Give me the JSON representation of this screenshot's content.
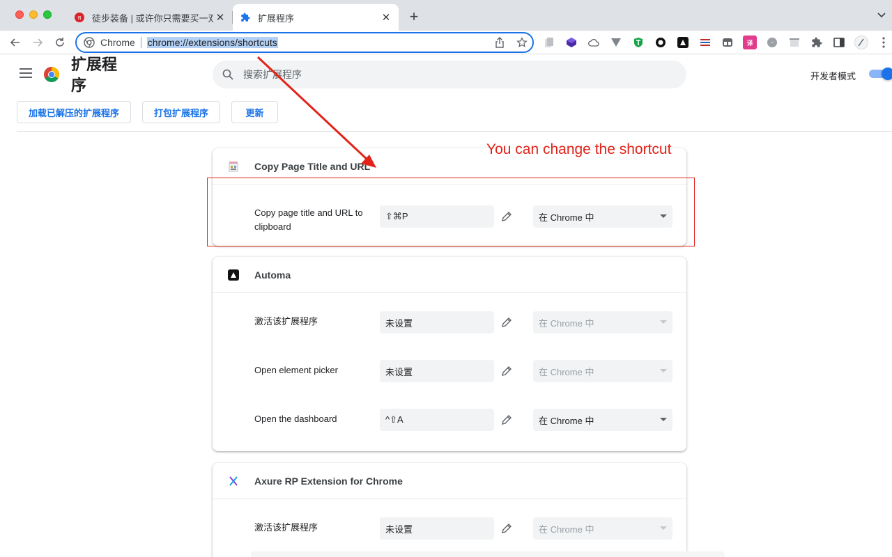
{
  "browser": {
    "tabs": [
      {
        "title": "徒步装备 | 或许你只需要买一双鞋",
        "favicon": "red-circle-logo",
        "active": false
      },
      {
        "title": "扩展程序",
        "favicon": "puzzle-icon",
        "active": true
      }
    ],
    "omnibox": {
      "chip": "Chrome",
      "url": "chrome://extensions/shortcuts"
    }
  },
  "header": {
    "title": "扩展程序",
    "search_placeholder": "搜索扩展程序",
    "devmode_label": "开发者模式",
    "devmode_on": true
  },
  "actions": {
    "load_unpacked": "加载已解压的扩展程序",
    "pack": "打包扩展程序",
    "update": "更新"
  },
  "extensions": [
    {
      "name": "Copy Page Title and URL",
      "icon": "copy-title-icon",
      "commands": [
        {
          "label": "Copy page title and URL to clipboard",
          "shortcut": "⇧⌘P",
          "scope": "在 Chrome 中",
          "scope_enabled": true
        }
      ]
    },
    {
      "name": "Automa",
      "icon": "automa-icon",
      "commands": [
        {
          "label": "激活该扩展程序",
          "shortcut": "未设置",
          "scope": "在 Chrome 中",
          "scope_enabled": false
        },
        {
          "label": "Open element picker",
          "shortcut": "未设置",
          "scope": "在 Chrome 中",
          "scope_enabled": false
        },
        {
          "label": "Open the dashboard",
          "shortcut": "^⇧A",
          "scope": "在 Chrome 中",
          "scope_enabled": true
        }
      ]
    },
    {
      "name": "Axure RP Extension for Chrome",
      "icon": "axure-icon",
      "commands": [
        {
          "label": "激活该扩展程序",
          "shortcut": "未设置",
          "scope": "在 Chrome 中",
          "scope_enabled": false
        }
      ]
    }
  ],
  "annotation": {
    "text": "You can change the shortcut",
    "color": "#e2231a"
  },
  "colors": {
    "accent": "#1a73e8",
    "annotation": "#e2231a"
  }
}
